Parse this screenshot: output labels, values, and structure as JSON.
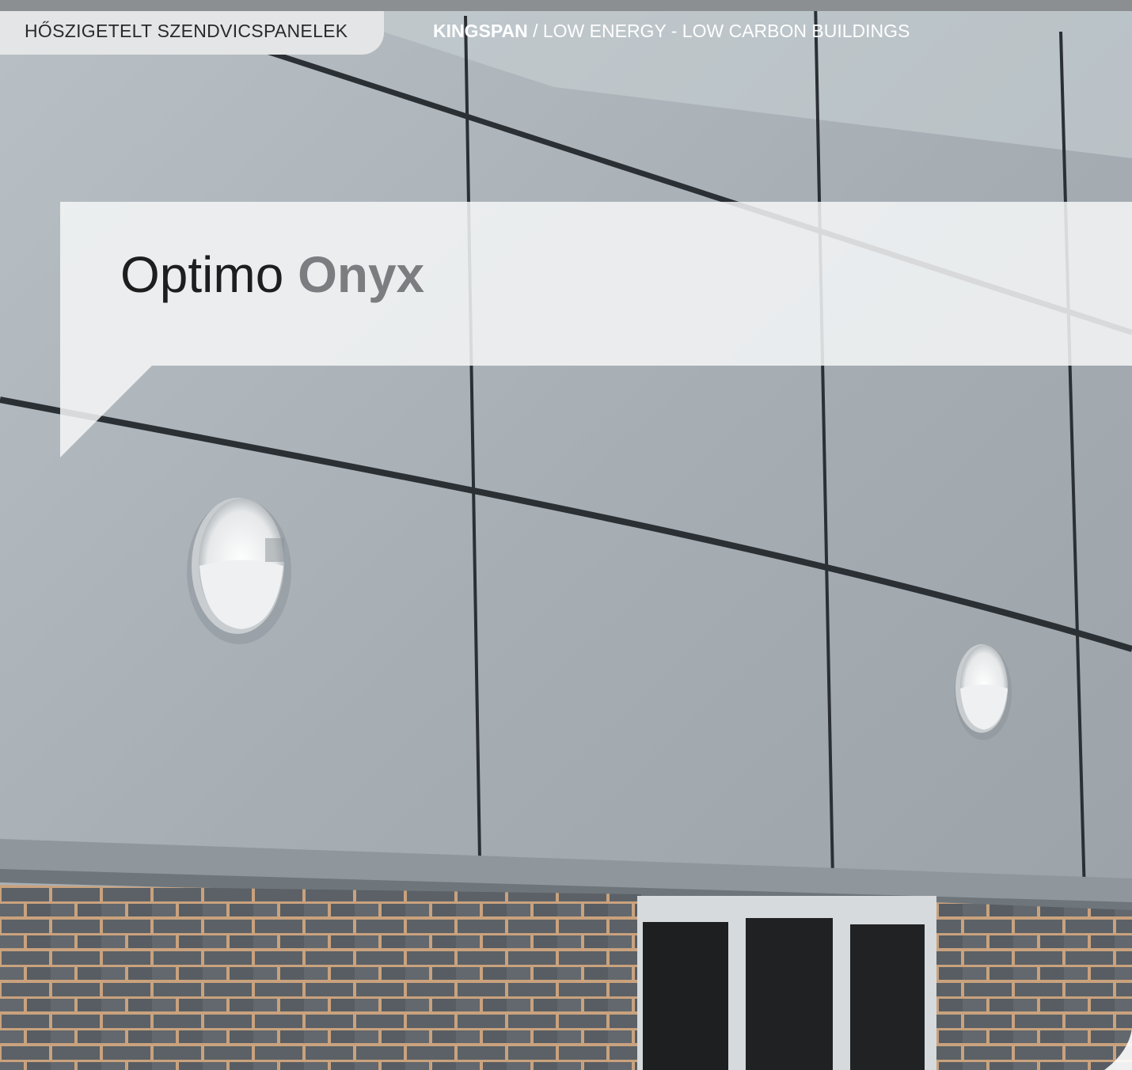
{
  "header": {
    "section_label": "HŐSZIGETELT SZENDVICSPANELEK",
    "brand": "KINGSPAN",
    "brand_separator": " / ",
    "tagline": "LOW ENERGY - LOW CARBON BUILDINGS"
  },
  "title": {
    "primary": "Optimo",
    "accent": "Onyx"
  },
  "colors": {
    "panel_grey": "#a9b2b8",
    "tab_background": "#e4e5e6",
    "accent_grey": "#7b7d80"
  }
}
